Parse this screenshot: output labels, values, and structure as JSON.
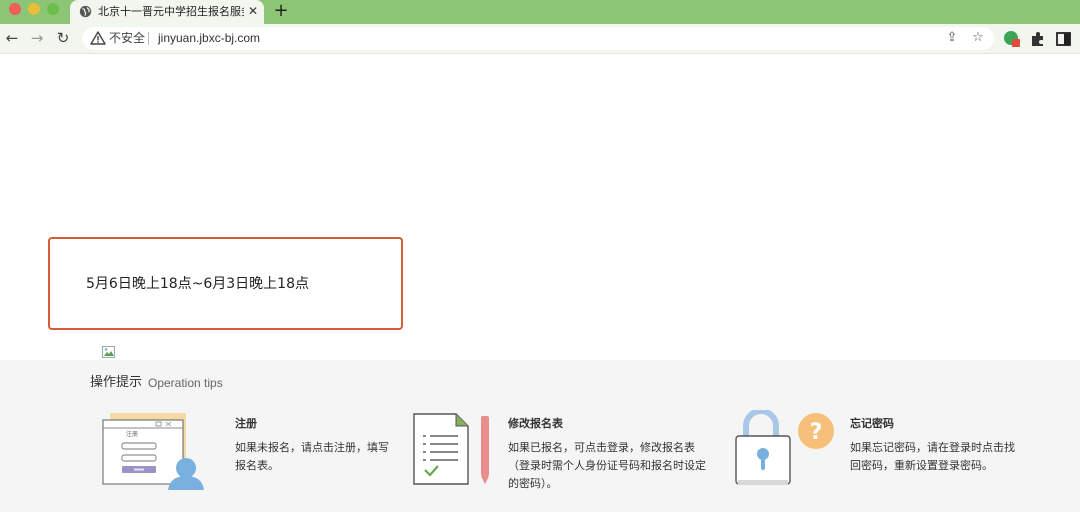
{
  "browser": {
    "tab_title": "北京十一晋元中学招生报名服务平",
    "security_label": "不安全",
    "url": "jinyuan.jbxc-bj.com",
    "colors": {
      "chrome": "#8cc575",
      "toolbar": "#f1f6ee"
    }
  },
  "notice": {
    "text": "5月6日晚上18点~6月3日晚上18点",
    "border_color": "#d65c34"
  },
  "tips": {
    "title": "操作提示",
    "subtitle": "Operation tips",
    "items": [
      {
        "icon": "register-form-icon",
        "name": "注册",
        "desc_line1": "如果未报名，请点击注册，填写",
        "desc_line2": "报名表。",
        "desc_line3": ""
      },
      {
        "icon": "edit-form-icon",
        "name": "修改报名表",
        "desc_line1": "如果已报名，可点击登录，修改报名表",
        "desc_line2": "（登录时需个人身份证号码和报名时设定",
        "desc_line3": "的密码）。"
      },
      {
        "icon": "lock-question-icon",
        "name": "忘记密码",
        "desc_line1": "如果忘记密码，请在登录时点击找",
        "desc_line2": "回密码，重新设置登录密码。",
        "desc_line3": ""
      }
    ],
    "illustration_labels": {
      "register_form_heading": "注册"
    }
  }
}
